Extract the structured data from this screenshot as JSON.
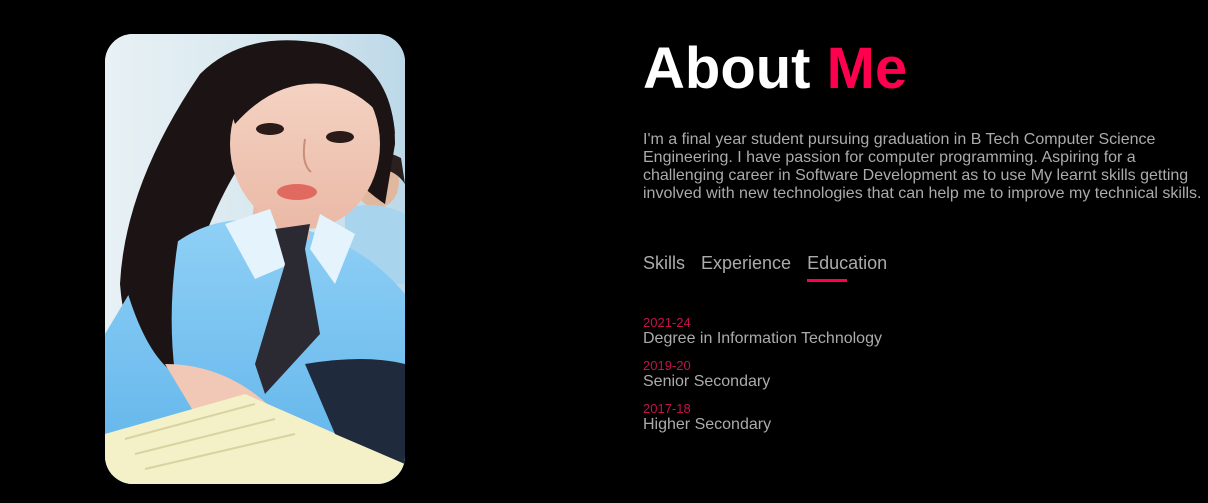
{
  "about": {
    "title_main": "About",
    "title_accent": "Me",
    "intro": "I'm a final year student pursuing graduation in B Tech Computer Science Engineering. I have passion for computer programming. Aspiring for a challenging career in Software Development as to use My learnt skills getting involved with new technologies that can help me to improve my technical skills."
  },
  "tabs": [
    {
      "label": "Skills",
      "active": false
    },
    {
      "label": "Experience",
      "active": false
    },
    {
      "label": "Education",
      "active": true
    }
  ],
  "education": [
    {
      "year": "2021-24",
      "degree": "Degree in Information Technology"
    },
    {
      "year": "2019-20",
      "degree": "Senior Secondary"
    },
    {
      "year": "2017-18",
      "degree": "Higher Secondary"
    }
  ],
  "colors": {
    "background": "#000000",
    "accent": "#ff004f",
    "year": "#c2134f",
    "text": "#ababab",
    "heading": "#ffffff"
  },
  "icons": {
    "profile_photo": "profile-photo"
  }
}
